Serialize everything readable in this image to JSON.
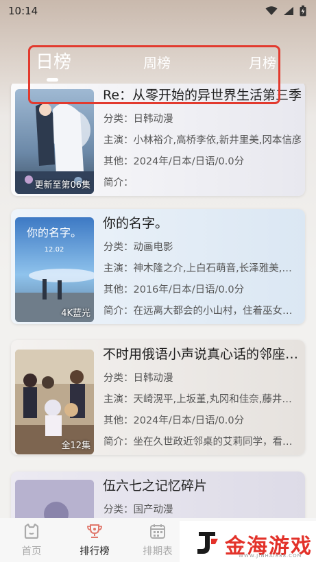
{
  "status_bar": {
    "time": "10:14"
  },
  "tabs": {
    "day": "日榜",
    "week": "周榜",
    "month": "月榜",
    "active": "day"
  },
  "items": [
    {
      "title": "Re：从零开始的异世界生活第三季",
      "category": "分类：日韩动漫",
      "cast": "主演：小林裕介,高桥李依,新井里美,冈本信彦",
      "other": "其他：2024年/日本/日语/0.0分",
      "summary": "简介：",
      "badge": "更新至第06集"
    },
    {
      "title": "你的名字。",
      "category": "分类：动画电影",
      "cast": "主演：神木隆之介,上白石萌音,长泽雅美,市原悦子",
      "other": "其他：2016年/日本/日语/0.0分",
      "summary": "简介：在远离大都会的小山村，住着巫女世家出身的高中女孩",
      "badge": "4K蓝光",
      "poster_text": "你的名字。",
      "poster_date": "12.02"
    },
    {
      "title": "不时用俄语小声说真心话的邻座艾莉同学",
      "category": "分类：日韩动漫",
      "cast": "主演：天崎滉平,上坂堇,丸冈和佳奈,藤井雪代",
      "other": "其他：2024年/日本/日语/0.0分",
      "summary": "简介：坐在久世政近邻桌的艾莉同学，看起来冷若冰霜",
      "badge": "全12集"
    },
    {
      "title": "伍六七之记忆碎片",
      "category": "分类：国产动漫"
    }
  ],
  "bottom_nav": {
    "home": "首页",
    "rank": "排行榜",
    "schedule": "排期表"
  },
  "watermark": {
    "brand": "金海游戏",
    "url": "WWW.JINHAI888.COM"
  },
  "colors": {
    "highlight": "#e23a2e",
    "brand_red": "#e3322a",
    "nav_active_icon": "#e0776b"
  }
}
